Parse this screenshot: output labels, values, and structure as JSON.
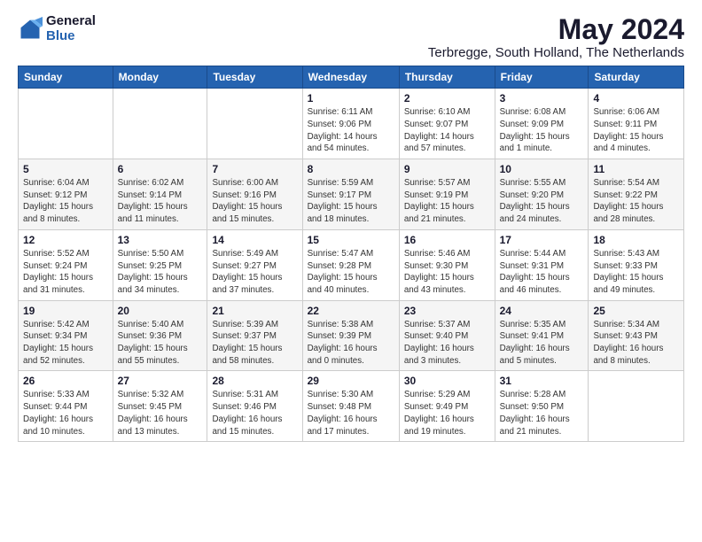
{
  "logo": {
    "general": "General",
    "blue": "Blue"
  },
  "title": "May 2024",
  "subtitle": "Terbregge, South Holland, The Netherlands",
  "days_of_week": [
    "Sunday",
    "Monday",
    "Tuesday",
    "Wednesday",
    "Thursday",
    "Friday",
    "Saturday"
  ],
  "weeks": [
    [
      {
        "day": "",
        "info": ""
      },
      {
        "day": "",
        "info": ""
      },
      {
        "day": "",
        "info": ""
      },
      {
        "day": "1",
        "info": "Sunrise: 6:11 AM\nSunset: 9:06 PM\nDaylight: 14 hours\nand 54 minutes."
      },
      {
        "day": "2",
        "info": "Sunrise: 6:10 AM\nSunset: 9:07 PM\nDaylight: 14 hours\nand 57 minutes."
      },
      {
        "day": "3",
        "info": "Sunrise: 6:08 AM\nSunset: 9:09 PM\nDaylight: 15 hours\nand 1 minute."
      },
      {
        "day": "4",
        "info": "Sunrise: 6:06 AM\nSunset: 9:11 PM\nDaylight: 15 hours\nand 4 minutes."
      }
    ],
    [
      {
        "day": "5",
        "info": "Sunrise: 6:04 AM\nSunset: 9:12 PM\nDaylight: 15 hours\nand 8 minutes."
      },
      {
        "day": "6",
        "info": "Sunrise: 6:02 AM\nSunset: 9:14 PM\nDaylight: 15 hours\nand 11 minutes."
      },
      {
        "day": "7",
        "info": "Sunrise: 6:00 AM\nSunset: 9:16 PM\nDaylight: 15 hours\nand 15 minutes."
      },
      {
        "day": "8",
        "info": "Sunrise: 5:59 AM\nSunset: 9:17 PM\nDaylight: 15 hours\nand 18 minutes."
      },
      {
        "day": "9",
        "info": "Sunrise: 5:57 AM\nSunset: 9:19 PM\nDaylight: 15 hours\nand 21 minutes."
      },
      {
        "day": "10",
        "info": "Sunrise: 5:55 AM\nSunset: 9:20 PM\nDaylight: 15 hours\nand 24 minutes."
      },
      {
        "day": "11",
        "info": "Sunrise: 5:54 AM\nSunset: 9:22 PM\nDaylight: 15 hours\nand 28 minutes."
      }
    ],
    [
      {
        "day": "12",
        "info": "Sunrise: 5:52 AM\nSunset: 9:24 PM\nDaylight: 15 hours\nand 31 minutes."
      },
      {
        "day": "13",
        "info": "Sunrise: 5:50 AM\nSunset: 9:25 PM\nDaylight: 15 hours\nand 34 minutes."
      },
      {
        "day": "14",
        "info": "Sunrise: 5:49 AM\nSunset: 9:27 PM\nDaylight: 15 hours\nand 37 minutes."
      },
      {
        "day": "15",
        "info": "Sunrise: 5:47 AM\nSunset: 9:28 PM\nDaylight: 15 hours\nand 40 minutes."
      },
      {
        "day": "16",
        "info": "Sunrise: 5:46 AM\nSunset: 9:30 PM\nDaylight: 15 hours\nand 43 minutes."
      },
      {
        "day": "17",
        "info": "Sunrise: 5:44 AM\nSunset: 9:31 PM\nDaylight: 15 hours\nand 46 minutes."
      },
      {
        "day": "18",
        "info": "Sunrise: 5:43 AM\nSunset: 9:33 PM\nDaylight: 15 hours\nand 49 minutes."
      }
    ],
    [
      {
        "day": "19",
        "info": "Sunrise: 5:42 AM\nSunset: 9:34 PM\nDaylight: 15 hours\nand 52 minutes."
      },
      {
        "day": "20",
        "info": "Sunrise: 5:40 AM\nSunset: 9:36 PM\nDaylight: 15 hours\nand 55 minutes."
      },
      {
        "day": "21",
        "info": "Sunrise: 5:39 AM\nSunset: 9:37 PM\nDaylight: 15 hours\nand 58 minutes."
      },
      {
        "day": "22",
        "info": "Sunrise: 5:38 AM\nSunset: 9:39 PM\nDaylight: 16 hours\nand 0 minutes."
      },
      {
        "day": "23",
        "info": "Sunrise: 5:37 AM\nSunset: 9:40 PM\nDaylight: 16 hours\nand 3 minutes."
      },
      {
        "day": "24",
        "info": "Sunrise: 5:35 AM\nSunset: 9:41 PM\nDaylight: 16 hours\nand 5 minutes."
      },
      {
        "day": "25",
        "info": "Sunrise: 5:34 AM\nSunset: 9:43 PM\nDaylight: 16 hours\nand 8 minutes."
      }
    ],
    [
      {
        "day": "26",
        "info": "Sunrise: 5:33 AM\nSunset: 9:44 PM\nDaylight: 16 hours\nand 10 minutes."
      },
      {
        "day": "27",
        "info": "Sunrise: 5:32 AM\nSunset: 9:45 PM\nDaylight: 16 hours\nand 13 minutes."
      },
      {
        "day": "28",
        "info": "Sunrise: 5:31 AM\nSunset: 9:46 PM\nDaylight: 16 hours\nand 15 minutes."
      },
      {
        "day": "29",
        "info": "Sunrise: 5:30 AM\nSunset: 9:48 PM\nDaylight: 16 hours\nand 17 minutes."
      },
      {
        "day": "30",
        "info": "Sunrise: 5:29 AM\nSunset: 9:49 PM\nDaylight: 16 hours\nand 19 minutes."
      },
      {
        "day": "31",
        "info": "Sunrise: 5:28 AM\nSunset: 9:50 PM\nDaylight: 16 hours\nand 21 minutes."
      },
      {
        "day": "",
        "info": ""
      }
    ]
  ]
}
